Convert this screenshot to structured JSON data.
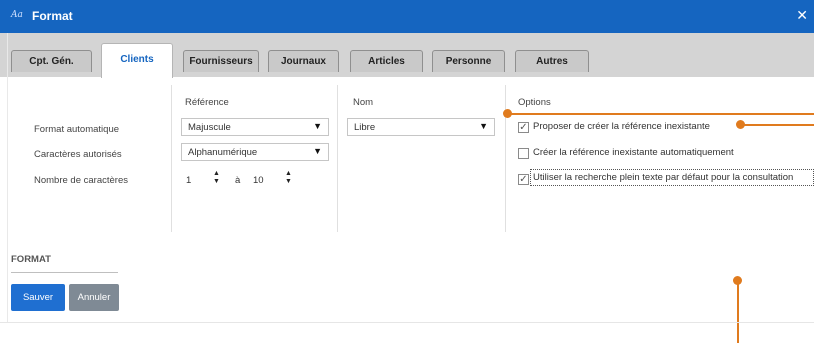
{
  "window": {
    "title": "Format",
    "app_icon": "Aa",
    "close_glyph": "✕"
  },
  "tabs": [
    {
      "label": "Cpt. Gén.",
      "active": false
    },
    {
      "label": "Clients",
      "active": true
    },
    {
      "label": "Fournisseurs",
      "active": false
    },
    {
      "label": "Journaux",
      "active": false
    },
    {
      "label": "Articles",
      "active": false
    },
    {
      "label": "Personne",
      "active": false
    },
    {
      "label": "Autres",
      "active": false
    }
  ],
  "form": {
    "row_labels": {
      "format_auto": "Format automatique",
      "caracteres": "Caractères autorisés",
      "nombre": "Nombre de caractères"
    },
    "reference": {
      "header": "Référence",
      "format_value": "Majuscule",
      "caracteres_value": "Alphanumérique",
      "min": "1",
      "separator": "à",
      "max": "10"
    },
    "nom": {
      "header": "Nom",
      "format_value": "Libre"
    },
    "options": {
      "header": "Options",
      "items": [
        {
          "label": "Proposer de créer la référence inexistante",
          "checked": true
        },
        {
          "label": "Créer la référence inexistante automatiquement",
          "checked": false
        },
        {
          "label": "Utiliser la recherche plein texte par défaut pour la consultation",
          "checked": true
        }
      ]
    }
  },
  "footer": {
    "section_title": "FORMAT",
    "save_label": "Sauver",
    "cancel_label": "Annuler"
  },
  "icons": {
    "dropdown": "▼",
    "spin_up": "▲",
    "spin_down": "▼",
    "check": "✓"
  },
  "colors": {
    "titlebar": "#1565c0",
    "accent_orange": "#e07b1e",
    "save_button": "#1f6fd1",
    "cancel_button": "#7f8a95"
  }
}
